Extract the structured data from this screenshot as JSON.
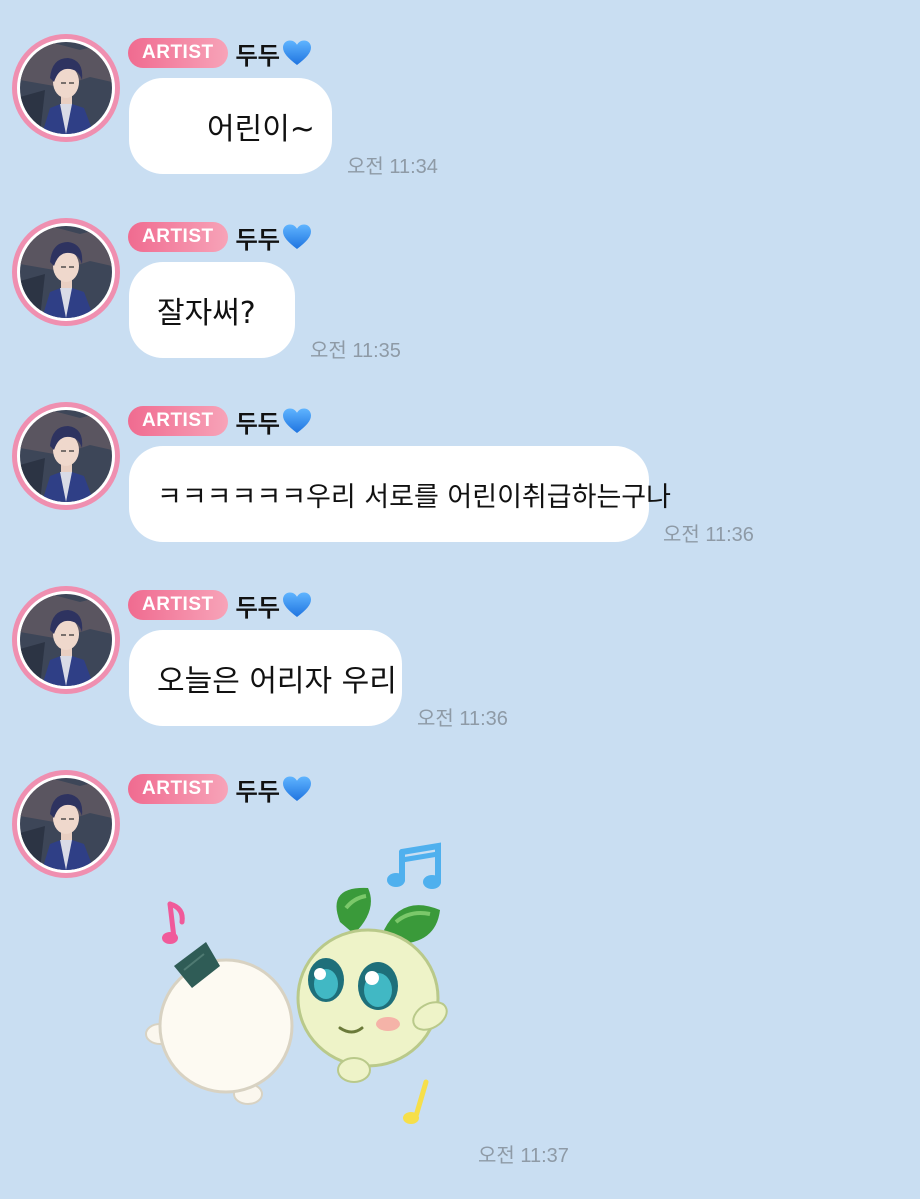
{
  "messages": [
    {
      "badge": "ARTIST",
      "name": "두두",
      "name_emoji": "blue-heart-icon",
      "text": "어린이~",
      "time": "오전 11:34"
    },
    {
      "badge": "ARTIST",
      "name": "두두",
      "name_emoji": "blue-heart-icon",
      "text": "잘자써?",
      "time": "오전 11:35"
    },
    {
      "badge": "ARTIST",
      "name": "두두",
      "name_emoji": "blue-heart-icon",
      "text": "ㅋㅋㅋㅋㅋㅋ우리 서로를 어린이취급하는구나",
      "time": "오전 11:36"
    },
    {
      "badge": "ARTIST",
      "name": "두두",
      "name_emoji": "blue-heart-icon",
      "text": "오늘은 어리자 우리",
      "time": "오전 11:36"
    },
    {
      "badge": "ARTIST",
      "name": "두두",
      "name_emoji": "blue-heart-icon",
      "sticker": "sprout-and-sheep-hug-sticker",
      "time": "오전 11:37"
    }
  ],
  "colors": {
    "background": "#c9def2",
    "bubble": "#ffffff",
    "badge_start": "#f06b90",
    "badge_end": "#f7a3b8",
    "avatar_ring": "#ef8fb0",
    "heart": "#2f8cf0",
    "time_text": "#8e9aa6"
  }
}
